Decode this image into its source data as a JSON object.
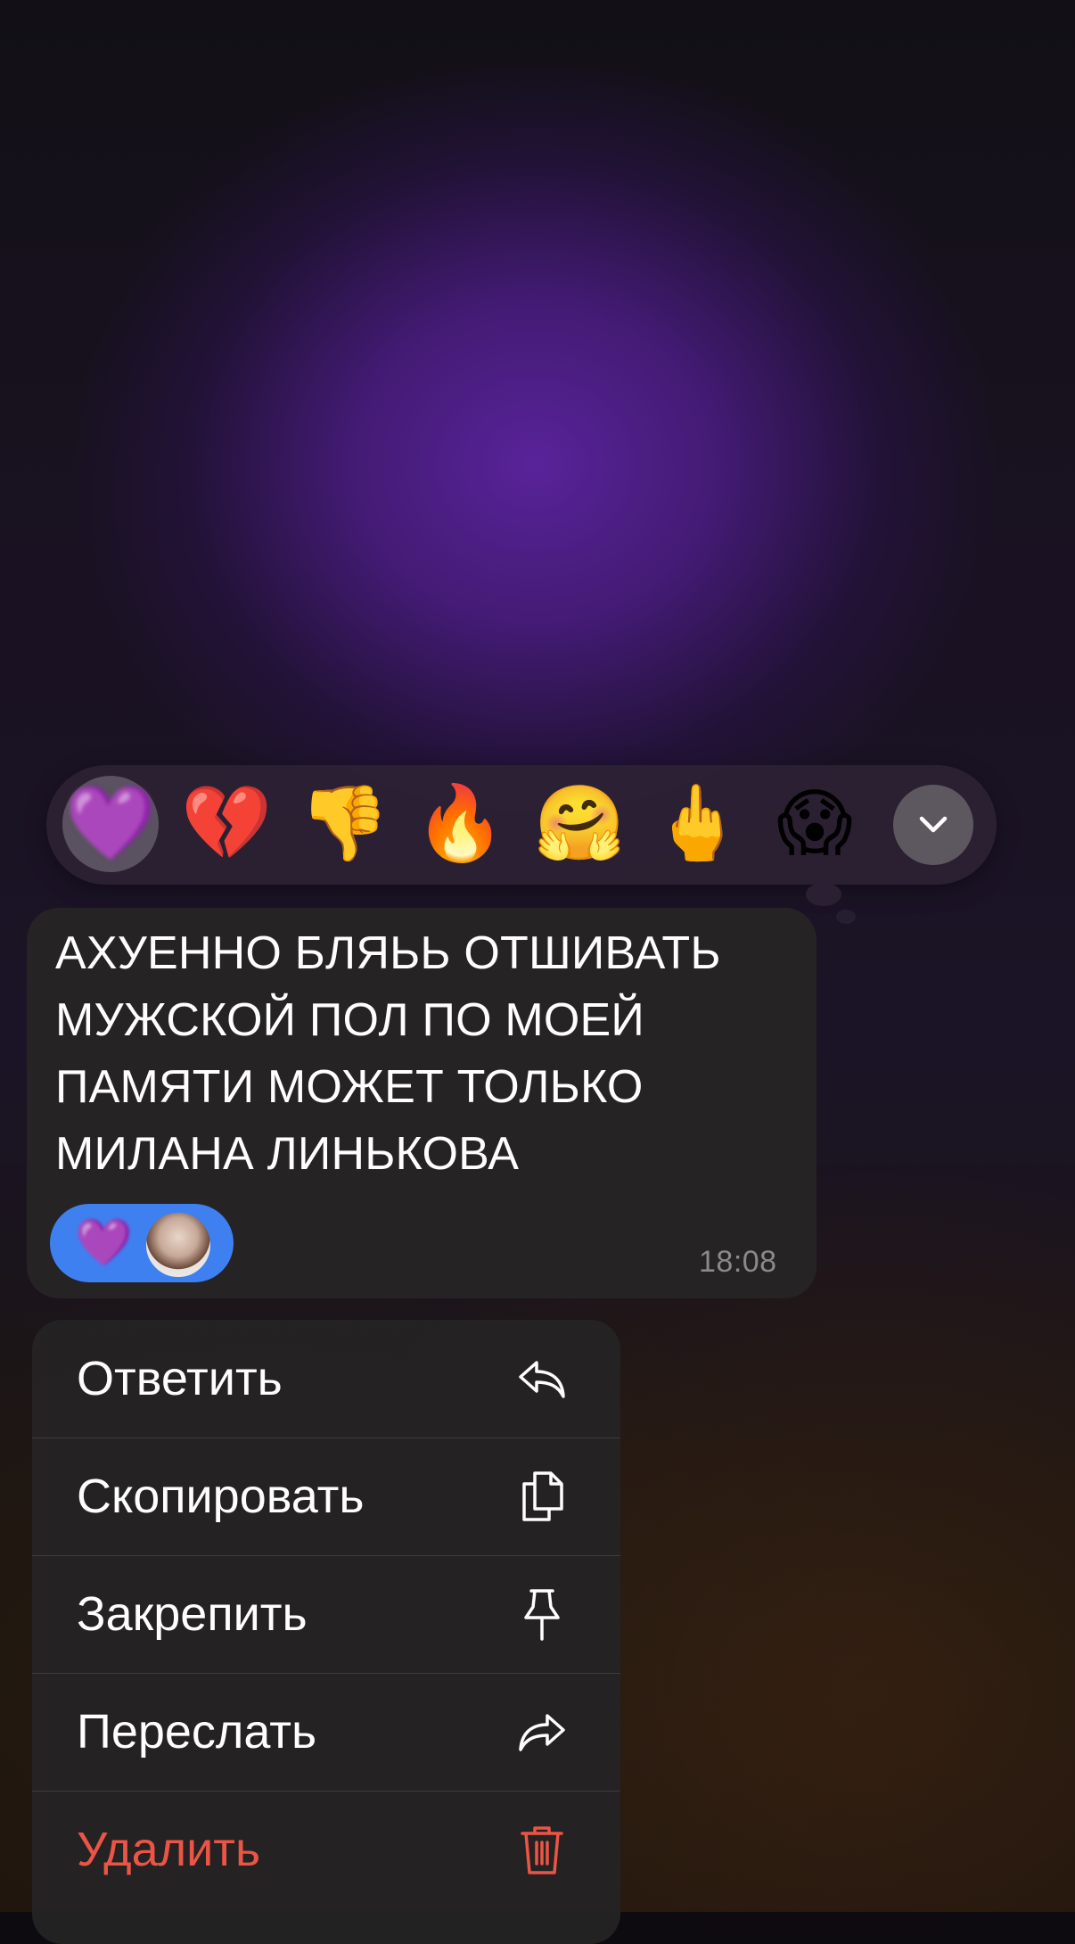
{
  "reactions": {
    "items": [
      {
        "name": "purple-heart",
        "emoji": "💜",
        "selected": true
      },
      {
        "name": "broken-heart",
        "emoji": "💔",
        "selected": false
      },
      {
        "name": "thumbs-down",
        "emoji": "👎",
        "selected": false
      },
      {
        "name": "fire",
        "emoji": "🔥",
        "selected": false
      },
      {
        "name": "hugging-face",
        "emoji": "🤗",
        "selected": false
      },
      {
        "name": "middle-finger",
        "emoji": "🖕",
        "selected": false
      },
      {
        "name": "screaming-face",
        "emoji": "😱",
        "selected": false
      }
    ],
    "expand_icon": "chevron-down-icon"
  },
  "message": {
    "text": "АХУЕННО БЛЯЬЬ ОТШИВАТЬ\nМУЖСКОЙ ПОЛ ПО МОЕЙ\nПАМЯТИ МОЖЕТ ТОЛЬКО\nМИЛАНА ЛИНЬКОВА",
    "time": "18:08",
    "reaction_chip": {
      "emoji": "💜",
      "color": "#3f80f0"
    }
  },
  "context_menu": {
    "items": [
      {
        "label": "Ответить",
        "icon": "reply-icon"
      },
      {
        "label": "Скопировать",
        "icon": "copy-icon"
      },
      {
        "label": "Закрепить",
        "icon": "pin-icon"
      },
      {
        "label": "Переслать",
        "icon": "forward-icon"
      },
      {
        "label": "Удалить",
        "icon": "trash-icon",
        "color": "#eb5545"
      }
    ]
  }
}
